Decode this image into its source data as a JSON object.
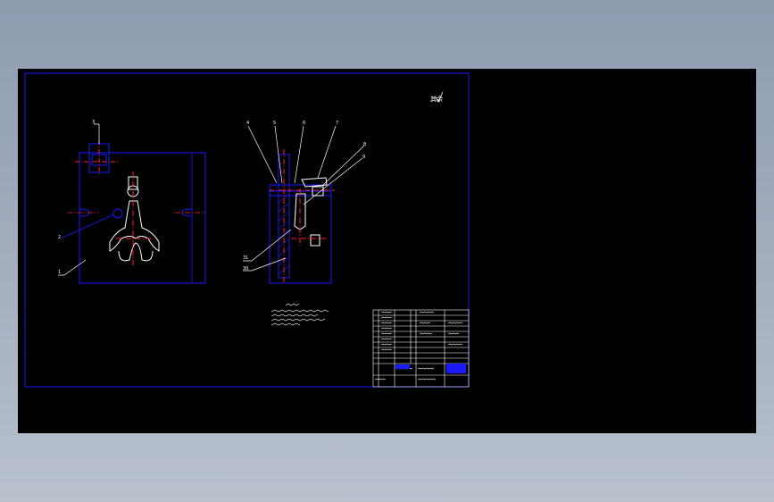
{
  "colors": {
    "background": "#000000",
    "frame": "#1a1aff",
    "outline": "#ffffff",
    "center_line": "#ff2020",
    "leader": "#ffffff",
    "hatch": "#1a1aff",
    "table_line": "#ffffff",
    "table_text": "#ffffff",
    "table_highlight": "#1a1aff"
  },
  "drawing": {
    "roughness_mark": "其余",
    "balloons_left": [
      "3",
      "2",
      "1"
    ],
    "balloons_right": [
      "4",
      "5",
      "6",
      "7",
      "8",
      "9",
      "31",
      "30"
    ]
  }
}
